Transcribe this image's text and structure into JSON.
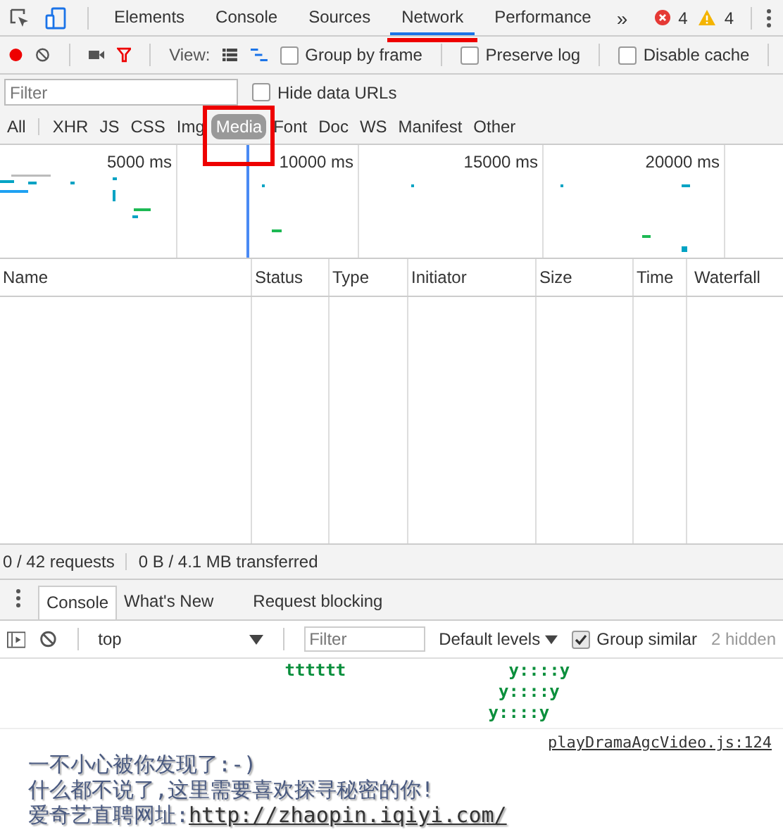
{
  "devtools_tabs": [
    {
      "label": "Elements",
      "selected": false,
      "marked": false
    },
    {
      "label": "Console",
      "selected": false,
      "marked": false
    },
    {
      "label": "Sources",
      "selected": false,
      "marked": false
    },
    {
      "label": "Network",
      "selected": true,
      "marked": true
    },
    {
      "label": "Performance",
      "selected": false,
      "marked": false
    }
  ],
  "more_tabs": "»",
  "errors": "4",
  "warnings": "4",
  "network_toolbar": {
    "recording": true,
    "view_label": "View:",
    "checkboxes": [
      {
        "label": "Group by frame",
        "checked": false
      },
      {
        "label": "Preserve log",
        "checked": false
      },
      {
        "label": "Disable cache",
        "checked": false
      }
    ]
  },
  "filter": {
    "placeholder": "Filter",
    "hide_data_urls": {
      "label": "Hide data URLs",
      "checked": false
    }
  },
  "type_filters": [
    {
      "label": "All",
      "selected": false,
      "marked": false
    },
    {
      "label": "XHR",
      "selected": false,
      "marked": false
    },
    {
      "label": "JS",
      "selected": false,
      "marked": false
    },
    {
      "label": "CSS",
      "selected": false,
      "marked": false
    },
    {
      "label": "Img",
      "selected": false,
      "marked": false
    },
    {
      "label": "Media",
      "selected": true,
      "marked": true
    },
    {
      "label": "Font",
      "selected": false,
      "marked": false
    },
    {
      "label": "Doc",
      "selected": false,
      "marked": false
    },
    {
      "label": "WS",
      "selected": false,
      "marked": false
    },
    {
      "label": "Manifest",
      "selected": false,
      "marked": false
    },
    {
      "label": "Other",
      "selected": false,
      "marked": false
    }
  ],
  "overview": {
    "ticks": [
      "5000 ms",
      "10000 ms",
      "15000 ms",
      "20000 ms"
    ]
  },
  "table": {
    "columns": [
      "Name",
      "Status",
      "Type",
      "Initiator",
      "Size",
      "Time",
      "Waterfall"
    ]
  },
  "status_bar": {
    "requests": "0 / 42 requests",
    "transferred": "0 B / 4.1 MB transferred"
  },
  "drawer_tabs": [
    {
      "label": "Console",
      "selected": true
    },
    {
      "label": "What's New",
      "selected": false
    },
    {
      "label": "Request blocking",
      "selected": false
    }
  ],
  "console_toolbar": {
    "context": "top",
    "filter_placeholder": "Filter",
    "levels": "Default levels",
    "group_similar": {
      "label": "Group similar",
      "checked": true
    },
    "hidden": "2 hidden"
  },
  "console": {
    "art_lines": [
      "                            tttttt                y::::y",
      "                                                 y::::y",
      "                                                y::::y"
    ],
    "source": "playDramaAgcVideo.js:124",
    "message_lines": [
      "一不小心被你发现了:-)",
      "什么都不说了,这里需要喜欢探寻秘密的你!"
    ],
    "link_prefix": "爱奇艺直聘网址:",
    "link": "http://zhaopin.iqiyi.com/"
  }
}
